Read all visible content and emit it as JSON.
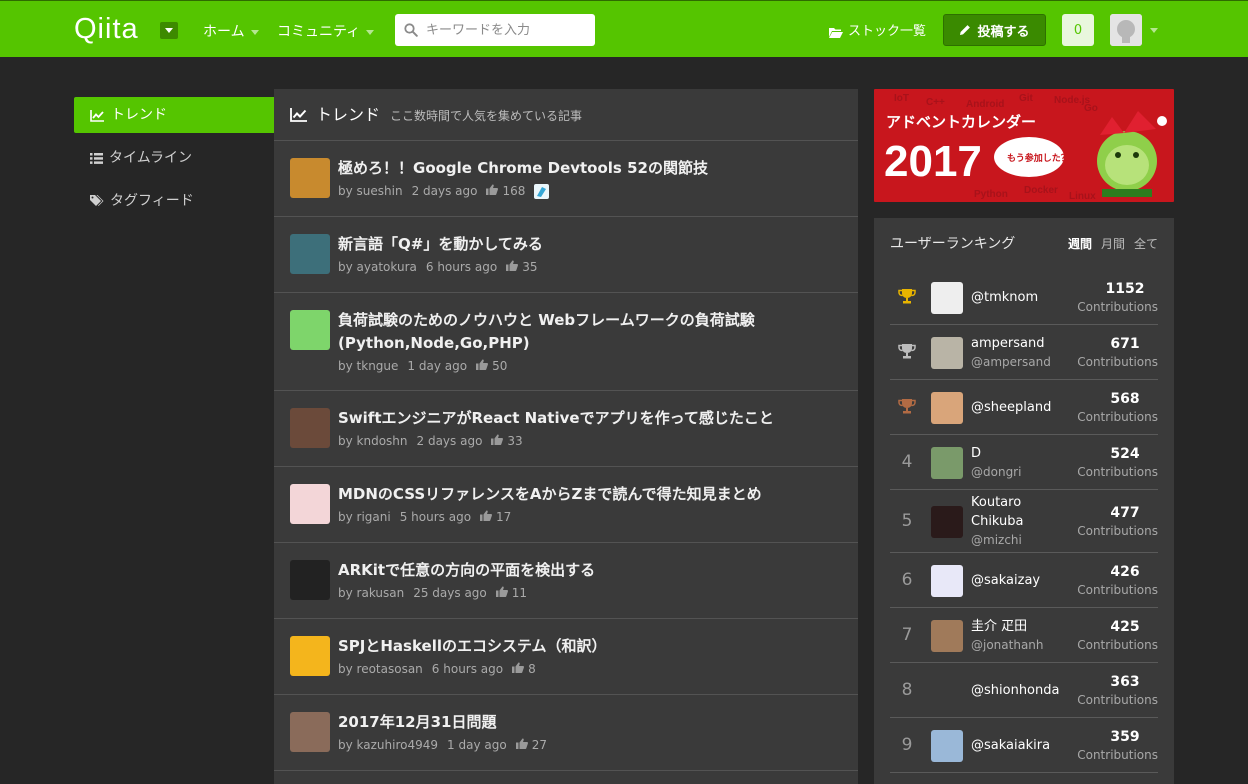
{
  "header": {
    "logo": "Qiita",
    "nav": [
      {
        "label": "ホーム"
      },
      {
        "label": "コミュニティ"
      }
    ],
    "search_placeholder": "キーワードを入力",
    "stock_label": "ストック一覧",
    "post_label": "投稿する",
    "notification_count": "0"
  },
  "sidebar": {
    "items": [
      {
        "label": "トレンド",
        "icon": "trend-icon",
        "active": true
      },
      {
        "label": "タイムライン",
        "icon": "list-icon",
        "active": false
      },
      {
        "label": "タグフィード",
        "icon": "tag-icon",
        "active": false
      }
    ]
  },
  "feed": {
    "title": "トレンド",
    "subtitle": "ここ数時間で人気を集めている記事",
    "items": [
      {
        "title": "極めろ！！Google Chrome Devtools 52の関節技",
        "author": "by sueshin",
        "time": "2 days ago",
        "likes": "168",
        "badge": true,
        "thumb": "#c88a2e"
      },
      {
        "title": "新言語「Q#」を動かしてみる",
        "author": "by ayatokura",
        "time": "6 hours ago",
        "likes": "35",
        "badge": false,
        "thumb": "#3d6f7a"
      },
      {
        "title": "負荷試験のためのノウハウと Webフレームワークの負荷試験 (Python,Node,Go,PHP)",
        "author": "by tkngue",
        "time": "1 day ago",
        "likes": "50",
        "badge": false,
        "thumb": "#7ed56b"
      },
      {
        "title": "SwiftエンジニアがReact Nativeでアプリを作って感じたこと",
        "author": "by kndoshn",
        "time": "2 days ago",
        "likes": "33",
        "badge": false,
        "thumb": "#6b4a3a"
      },
      {
        "title": "MDNのCSSリファレンスをAからZまで読んで得た知見まとめ",
        "author": "by rigani",
        "time": "5 hours ago",
        "likes": "17",
        "badge": false,
        "thumb": "#f3d6d8"
      },
      {
        "title": "ARKitで任意の方向の平面を検出する",
        "author": "by rakusan",
        "time": "25 days ago",
        "likes": "11",
        "badge": false,
        "thumb": "#222222"
      },
      {
        "title": "SPJとHaskellのエコシステム（和訳）",
        "author": "by reotasosan",
        "time": "6 hours ago",
        "likes": "8",
        "badge": false,
        "thumb": "#f4b51c"
      },
      {
        "title": "2017年12月31日問題",
        "author": "by kazuhiro4949",
        "time": "1 day ago",
        "likes": "27",
        "badge": false,
        "thumb": "#8a6b5a"
      }
    ]
  },
  "banner": {
    "title": "アドベントカレンダー",
    "year": "2017",
    "bubble": "もう参加した？",
    "bg_color": "#c8161d"
  },
  "ranking": {
    "title": "ユーザーランキング",
    "tabs": [
      {
        "label": "週間",
        "active": true
      },
      {
        "label": "月間",
        "active": false
      },
      {
        "label": "全て",
        "active": false
      }
    ],
    "unit": "Contributions",
    "rows": [
      {
        "rank": "",
        "medal": "gold",
        "name": "@tmknom",
        "handle": "",
        "score": "1152",
        "av": "#eeeeee"
      },
      {
        "rank": "",
        "medal": "silver",
        "name": "ampersand",
        "handle": "@ampersand",
        "score": "671",
        "av": "#b9b4a6"
      },
      {
        "rank": "",
        "medal": "bronze",
        "name": "@sheepland",
        "handle": "",
        "score": "568",
        "av": "#d9a57a"
      },
      {
        "rank": "4",
        "medal": "",
        "name": "D",
        "handle": "@dongri",
        "score": "524",
        "av": "#7a9a6a"
      },
      {
        "rank": "5",
        "medal": "",
        "name": "Koutaro Chikuba",
        "handle": "@mizchi",
        "score": "477",
        "av": "#2a1a1a"
      },
      {
        "rank": "6",
        "medal": "",
        "name": "@sakaizay",
        "handle": "",
        "score": "426",
        "av": "#e8e8f8"
      },
      {
        "rank": "7",
        "medal": "",
        "name": "圭介 疋田",
        "handle": "@jonathanh",
        "score": "425",
        "av": "#a07a5a"
      },
      {
        "rank": "8",
        "medal": "",
        "name": "@shionhonda",
        "handle": "",
        "score": "363",
        "av": "#3a3a3a"
      },
      {
        "rank": "9",
        "medal": "",
        "name": "@sakaiakira",
        "handle": "",
        "score": "359",
        "av": "#9ab8d8"
      }
    ]
  },
  "colors": {
    "brand": "#55c500",
    "background": "#262626",
    "panel": "#3a3a3a",
    "gold": "#e8b400",
    "silver": "#bcbcbc",
    "bronze": "#b26b44"
  }
}
